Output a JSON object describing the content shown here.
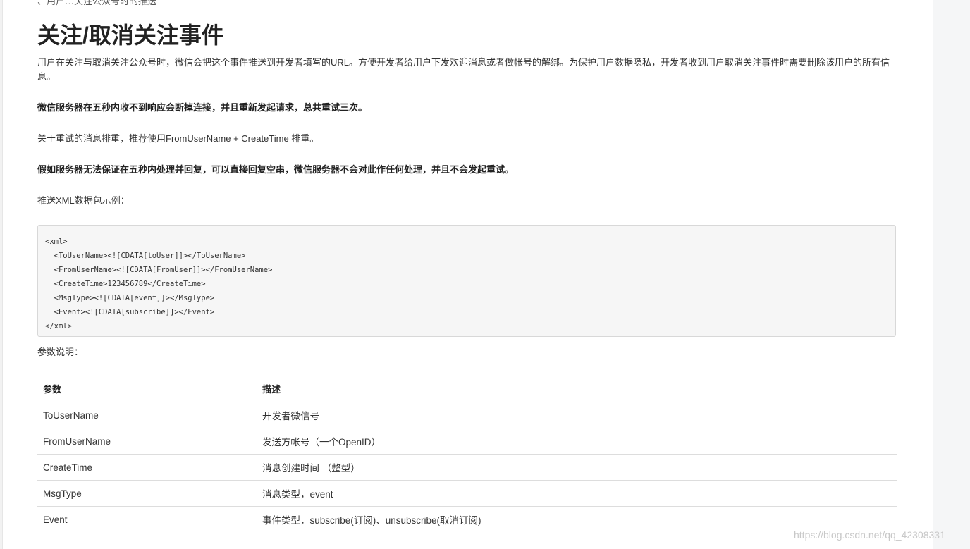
{
  "cut_line": "、用户…关注公众号时的推送",
  "title": "关注/取消关注事件",
  "paragraphs": {
    "intro": "用户在关注与取消关注公众号时，微信会把这个事件推送到开发者填写的URL。方便开发者给用户下发欢迎消息或者做帐号的解绑。为保护用户数据隐私，开发者收到用户取消关注事件时需要删除该用户的所有信息。",
    "retry": "微信服务器在五秒内收不到响应会断掉连接，并且重新发起请求，总共重试三次。",
    "dedup": "关于重试的消息排重，推荐使用FromUserName + CreateTime 排重。",
    "empty_reply": "假如服务器无法保证在五秒内处理并回复，可以直接回复空串，微信服务器不会对此作任何处理，并且不会发起重试。",
    "xml_example": "推送XML数据包示例：",
    "param_desc": "参数说明："
  },
  "code_lines": [
    "<xml>",
    "  <ToUserName><![CDATA[toUser]]></ToUserName>",
    "  <FromUserName><![CDATA[FromUser]]></FromUserName>",
    "  <CreateTime>123456789</CreateTime>",
    "  <MsgType><![CDATA[event]]></MsgType>",
    "  <Event><![CDATA[subscribe]]></Event>",
    "</xml>"
  ],
  "table": {
    "headers": [
      "参数",
      "描述"
    ],
    "rows": [
      [
        "ToUserName",
        "开发者微信号"
      ],
      [
        "FromUserName",
        "发送方帐号（一个OpenID）"
      ],
      [
        "CreateTime",
        "消息创建时间 （整型）"
      ],
      [
        "MsgType",
        "消息类型，event"
      ],
      [
        "Event",
        "事件类型，subscribe(订阅)、unsubscribe(取消订阅)"
      ]
    ]
  },
  "watermark": "https://blog.csdn.net/qq_42308331"
}
